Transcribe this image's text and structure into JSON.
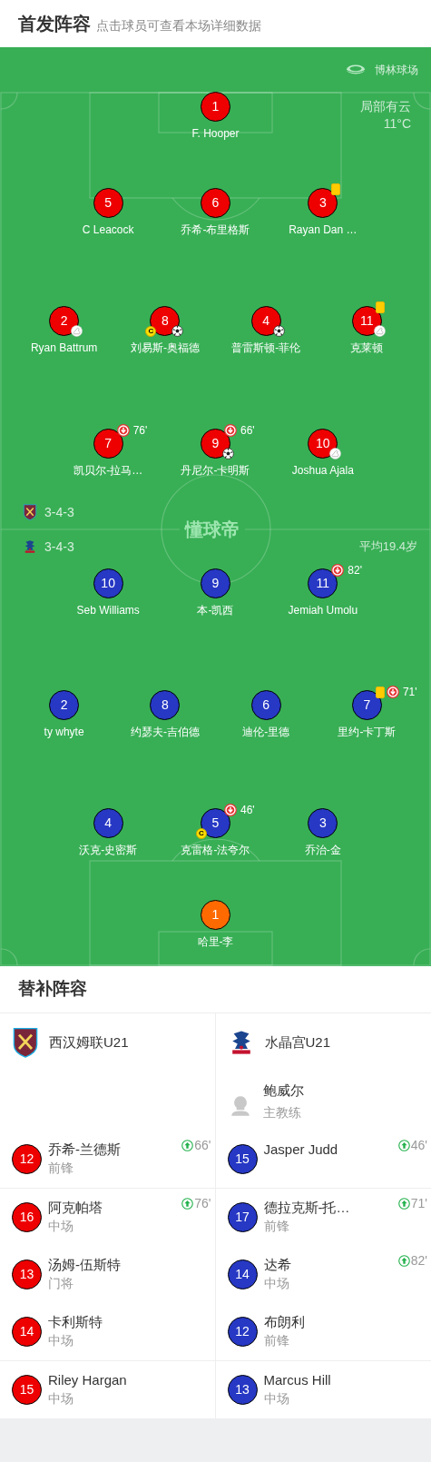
{
  "header": {
    "title": "首发阵容",
    "subtitle": "点击球员可查看本场详细数据"
  },
  "pitch": {
    "stadium": "博林球场",
    "weather": "局部有云",
    "temperature": "11°C",
    "logo_text": "懂球帝",
    "average_age": "平均19.4岁",
    "home": {
      "formation": "3-4-3",
      "color": "#ee0000",
      "lines": [
        [
          {
            "number": "1",
            "name": "F. Hooper"
          }
        ],
        [
          {
            "number": "5",
            "name": "C Leacock"
          },
          {
            "number": "6",
            "name": "乔希-布里格斯"
          },
          {
            "number": "3",
            "name": "Rayan Dan …",
            "events": [
              {
                "kind": "yellow_card"
              }
            ]
          }
        ],
        [
          {
            "number": "2",
            "name": "Ryan Battrum",
            "events": [
              {
                "kind": "assist"
              }
            ]
          },
          {
            "number": "8",
            "name": "刘易斯-奥福德",
            "events": [
              {
                "kind": "captain",
                "label": "C"
              },
              {
                "kind": "goal"
              }
            ]
          },
          {
            "number": "4",
            "name": "普雷斯顿-菲伦",
            "events": [
              {
                "kind": "goal"
              }
            ]
          },
          {
            "number": "11",
            "name": "克莱顿",
            "events": [
              {
                "kind": "yellow_card"
              },
              {
                "kind": "assist"
              }
            ]
          }
        ],
        [
          {
            "number": "7",
            "name": "凯贝尔-拉马…",
            "events": [
              {
                "kind": "sub_out",
                "minute": "76'"
              }
            ]
          },
          {
            "number": "9",
            "name": "丹尼尔-卡明斯",
            "events": [
              {
                "kind": "sub_out",
                "minute": "66'"
              },
              {
                "kind": "goal"
              }
            ]
          },
          {
            "number": "10",
            "name": "Joshua Ajala",
            "events": [
              {
                "kind": "assist"
              }
            ]
          }
        ]
      ]
    },
    "away": {
      "formation": "3-4-3",
      "color": "#2638c4",
      "lines": [
        [
          {
            "number": "10",
            "name": "Seb Williams"
          },
          {
            "number": "9",
            "name": "本-凯西"
          },
          {
            "number": "11",
            "name": "Jemiah Umolu",
            "events": [
              {
                "kind": "sub_out",
                "minute": "82'"
              }
            ]
          }
        ],
        [
          {
            "number": "2",
            "name": "ty whyte"
          },
          {
            "number": "8",
            "name": "约瑟夫-吉伯德"
          },
          {
            "number": "6",
            "name": "迪伦-里德"
          },
          {
            "number": "7",
            "name": "里约-卡丁斯",
            "events": [
              {
                "kind": "yellow_card"
              },
              {
                "kind": "sub_out",
                "minute": "71'"
              }
            ]
          }
        ],
        [
          {
            "number": "4",
            "name": "沃克-史密斯"
          },
          {
            "number": "5",
            "name": "克雷格-法夸尔",
            "events": [
              {
                "kind": "captain",
                "label": "C"
              },
              {
                "kind": "sub_out",
                "minute": "46'"
              }
            ]
          },
          {
            "number": "3",
            "name": "乔治-金"
          }
        ],
        [
          {
            "number": "1",
            "name": "哈里-李",
            "color": "#ff6a00"
          }
        ]
      ]
    }
  },
  "substitutes": {
    "title": "替补阵容",
    "home": {
      "team": "西汉姆联U21",
      "color": "#ee0000",
      "players": [
        {
          "number": "12",
          "name": "乔希-兰德斯",
          "position": "前锋",
          "minute": "66'"
        },
        {
          "number": "16",
          "name": "阿克帕塔",
          "position": "中场",
          "minute": "76'"
        },
        {
          "number": "13",
          "name": "汤姆-伍斯特",
          "position": "门将"
        },
        {
          "number": "14",
          "name": "卡利斯特",
          "position": "中场"
        },
        {
          "number": "15",
          "name": "Riley Hargan",
          "position": "中场"
        }
      ]
    },
    "away": {
      "team": "水晶宫U21",
      "color": "#2638c4",
      "coach": {
        "name": "鲍威尔",
        "role": "主教练"
      },
      "players": [
        {
          "number": "15",
          "name": "Jasper Judd",
          "minute": "46'"
        },
        {
          "number": "17",
          "name": "德拉克斯-托…",
          "position": "前锋",
          "minute": "71'"
        },
        {
          "number": "14",
          "name": "达希",
          "position": "中场",
          "minute": "82'"
        },
        {
          "number": "12",
          "name": "布朗利",
          "position": "前锋"
        },
        {
          "number": "13",
          "name": "Marcus Hill",
          "position": "中场"
        }
      ]
    }
  }
}
